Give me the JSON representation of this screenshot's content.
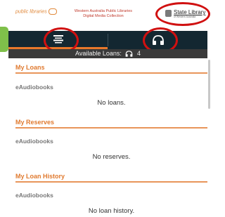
{
  "header": {
    "left_logo_text": "public libraries",
    "title_line1": "Western Australia Public Libraries",
    "title_line2": "Digital Media Collection",
    "state_library_name": "State Library",
    "state_library_subtitle": "of Western Australia"
  },
  "tabs": [
    {
      "icon": "list-icon",
      "selected": true
    },
    {
      "icon": "headphones-icon",
      "selected": false
    }
  ],
  "available_bar": {
    "label": "Available Loans:",
    "icon": "headphones-icon",
    "count": "4"
  },
  "sections": [
    {
      "title": "My Loans",
      "category": "eAudiobooks",
      "message": "No loans."
    },
    {
      "title": "My Reserves",
      "category": "eAudiobooks",
      "message": "No reserves."
    },
    {
      "title": "My Loan History",
      "category": "eAudiobooks",
      "message": "No loan history."
    }
  ],
  "colors": {
    "accent": "#e07a2f",
    "tabbar": "#132731",
    "highlight": "#d01010"
  }
}
